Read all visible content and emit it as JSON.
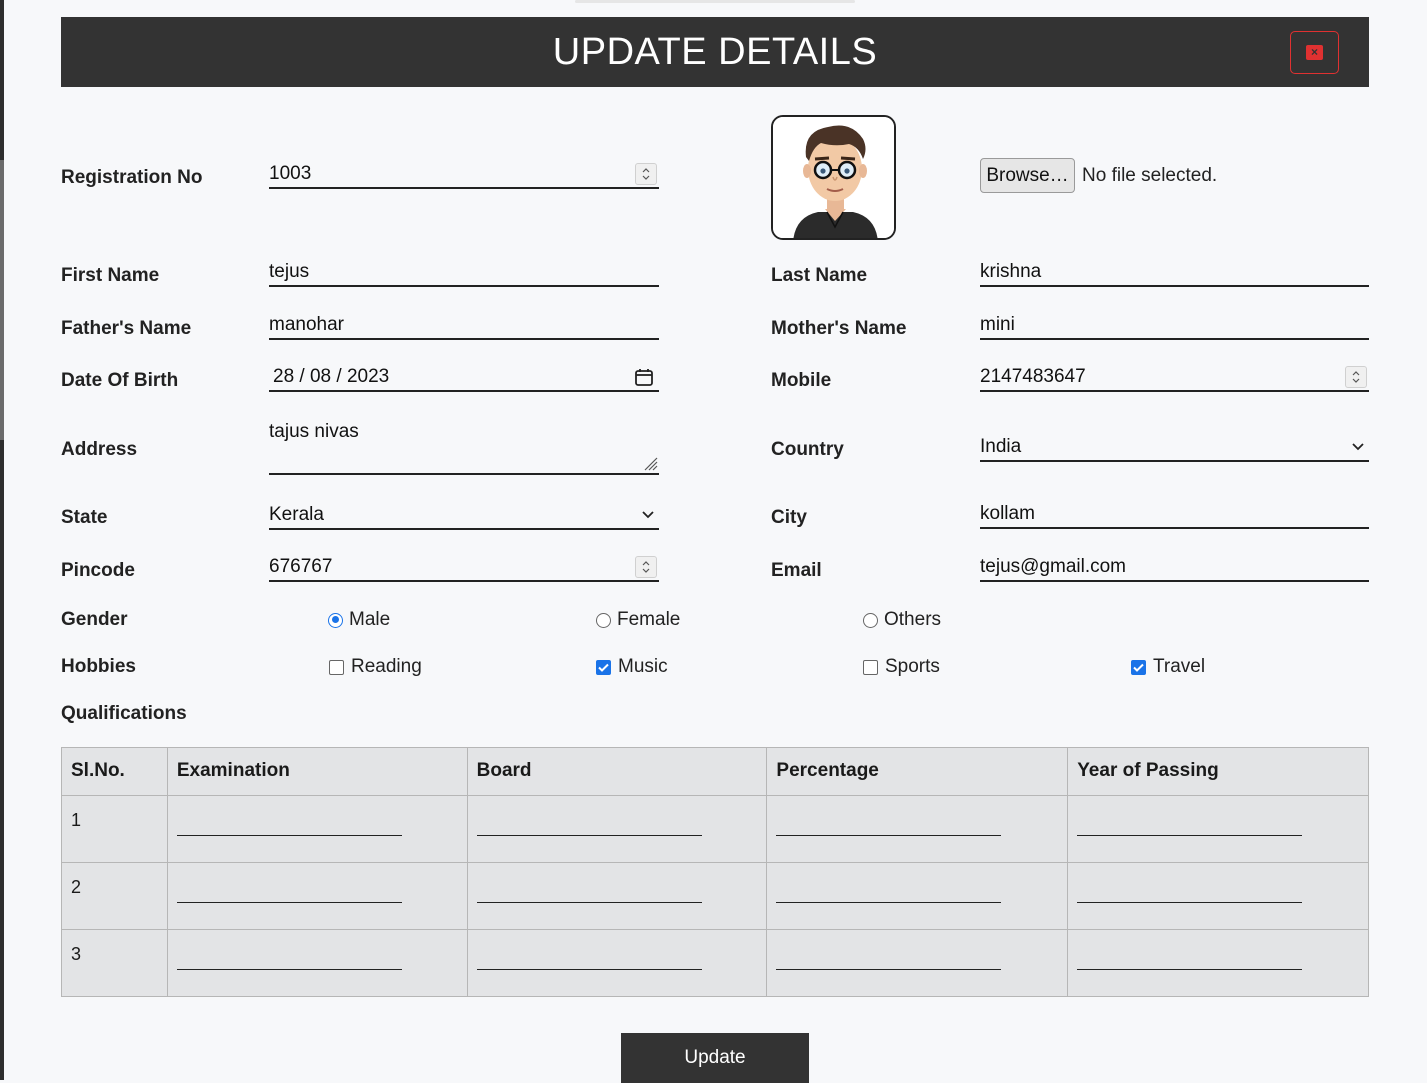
{
  "header": {
    "title": "UPDATE DETAILS",
    "close_icon": "close-icon",
    "close_color": "#e03131"
  },
  "photo": {
    "avatar_icon": "avatar-icon"
  },
  "file_upload": {
    "button_label": "Browse…",
    "status": "No file selected."
  },
  "fields": {
    "registration_no": {
      "label": "Registration No",
      "value": "1003"
    },
    "first_name": {
      "label": "First Name",
      "value": "tejus"
    },
    "last_name": {
      "label": "Last Name",
      "value": "krishna"
    },
    "fathers_name": {
      "label": "Father's Name",
      "value": "manohar"
    },
    "mothers_name": {
      "label": "Mother's Name",
      "value": "mini"
    },
    "dob": {
      "label": "Date Of Birth",
      "value": "28 / 08 / 2023"
    },
    "mobile": {
      "label": "Mobile",
      "value": "2147483647"
    },
    "address": {
      "label": "Address",
      "value": "tajus nivas"
    },
    "country": {
      "label": "Country",
      "value": "India"
    },
    "state": {
      "label": "State",
      "value": "Kerala"
    },
    "city": {
      "label": "City",
      "value": "kollam"
    },
    "pincode": {
      "label": "Pincode",
      "value": "676767"
    },
    "email": {
      "label": "Email",
      "value": "tejus@gmail.com"
    }
  },
  "gender": {
    "label": "Gender",
    "options": [
      {
        "label": "Male",
        "checked": true
      },
      {
        "label": "Female",
        "checked": false
      },
      {
        "label": "Others",
        "checked": false
      }
    ]
  },
  "hobbies": {
    "label": "Hobbies",
    "options": [
      {
        "label": "Reading",
        "checked": false
      },
      {
        "label": "Music",
        "checked": true
      },
      {
        "label": "Sports",
        "checked": false
      },
      {
        "label": "Travel",
        "checked": true
      }
    ]
  },
  "qualifications": {
    "label": "Qualifications",
    "columns": [
      "Sl.No.",
      "Examination",
      "Board",
      "Percentage",
      "Year of Passing"
    ],
    "rows": [
      "1",
      "2",
      "3"
    ]
  },
  "submit": {
    "label": "Update"
  },
  "colors": {
    "header_bg": "#333333",
    "accent": "#1a73e8",
    "page_bg": "#f7f8fa"
  }
}
